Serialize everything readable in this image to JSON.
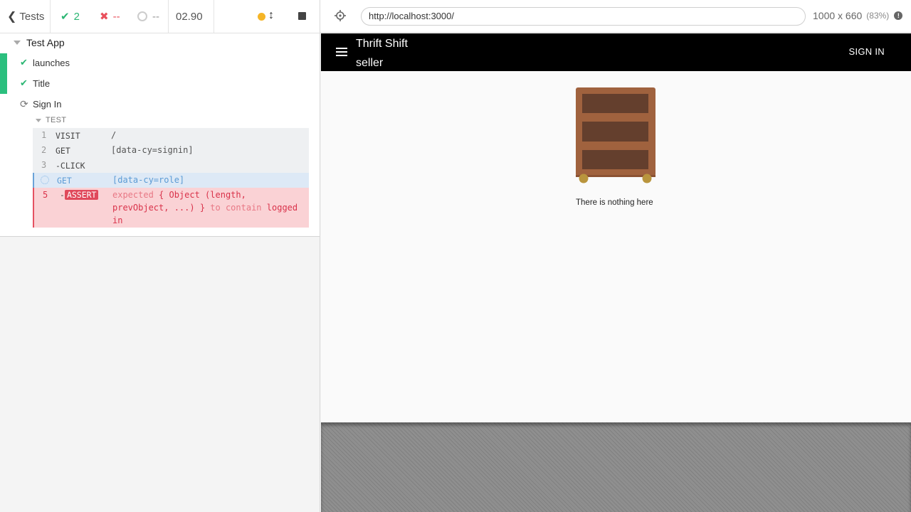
{
  "reporter": {
    "tests_label": "Tests",
    "stats": {
      "passed": "2",
      "failed": "--",
      "pending": "--"
    },
    "duration": "02.90",
    "suite": {
      "title": "Test App",
      "tests": [
        {
          "title": "launches",
          "state": "passed"
        },
        {
          "title": "Title",
          "state": "passed"
        },
        {
          "title": "Sign In",
          "state": "running"
        }
      ],
      "hooks_label": "TEST"
    },
    "commands": [
      {
        "num": "1",
        "name": "VISIT",
        "message": "/"
      },
      {
        "num": "2",
        "name": "GET",
        "message": "[data-cy=signin]"
      },
      {
        "num": "3",
        "name": "-CLICK",
        "message": ""
      },
      {
        "num": "",
        "name": "GET",
        "message": "[data-cy=role]"
      },
      {
        "num": "5",
        "name_prefix": "-",
        "name": "ASSERT",
        "message_parts": [
          "expected",
          "{ Object (length, prevObject, ...) }",
          "to contain",
          "logged in"
        ]
      }
    ]
  },
  "aut": {
    "url": "http://localhost:3000/",
    "viewport": "1000 x 660",
    "scale": "(83%)",
    "app": {
      "title_line1": "Thrift Shift",
      "title_line2": "seller",
      "signin_label": "SIGN IN",
      "empty_message": "There is nothing here"
    }
  },
  "colors": {
    "passed": "#2bb673",
    "failed": "#e94f5b",
    "running_indicator": "#f5b527",
    "appbar": "#000000",
    "drawer_body": "#a0623e",
    "drawer_slot": "#643f2d",
    "drawer_wheel": "#b9953d"
  }
}
